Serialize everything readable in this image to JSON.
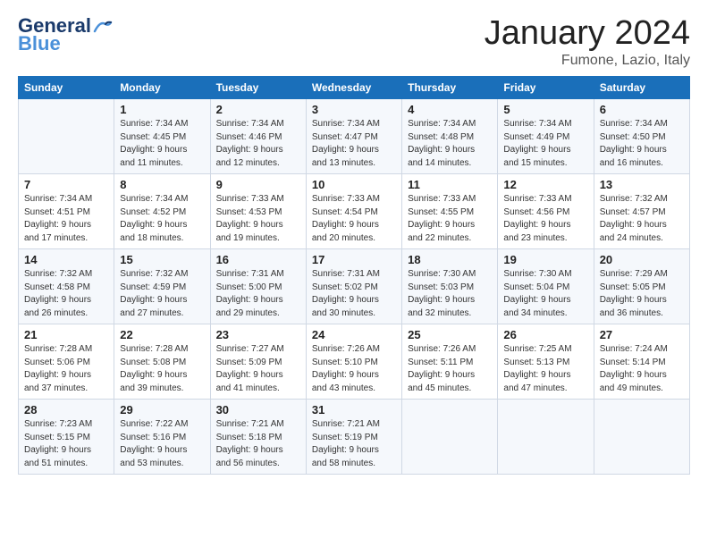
{
  "header": {
    "logo_general": "General",
    "logo_blue": "Blue",
    "month_title": "January 2024",
    "subtitle": "Fumone, Lazio, Italy"
  },
  "days_of_week": [
    "Sunday",
    "Monday",
    "Tuesday",
    "Wednesday",
    "Thursday",
    "Friday",
    "Saturday"
  ],
  "weeks": [
    [
      {
        "day": "",
        "info": ""
      },
      {
        "day": "1",
        "info": "Sunrise: 7:34 AM\nSunset: 4:45 PM\nDaylight: 9 hours\nand 11 minutes."
      },
      {
        "day": "2",
        "info": "Sunrise: 7:34 AM\nSunset: 4:46 PM\nDaylight: 9 hours\nand 12 minutes."
      },
      {
        "day": "3",
        "info": "Sunrise: 7:34 AM\nSunset: 4:47 PM\nDaylight: 9 hours\nand 13 minutes."
      },
      {
        "day": "4",
        "info": "Sunrise: 7:34 AM\nSunset: 4:48 PM\nDaylight: 9 hours\nand 14 minutes."
      },
      {
        "day": "5",
        "info": "Sunrise: 7:34 AM\nSunset: 4:49 PM\nDaylight: 9 hours\nand 15 minutes."
      },
      {
        "day": "6",
        "info": "Sunrise: 7:34 AM\nSunset: 4:50 PM\nDaylight: 9 hours\nand 16 minutes."
      }
    ],
    [
      {
        "day": "7",
        "info": "Sunrise: 7:34 AM\nSunset: 4:51 PM\nDaylight: 9 hours\nand 17 minutes."
      },
      {
        "day": "8",
        "info": "Sunrise: 7:34 AM\nSunset: 4:52 PM\nDaylight: 9 hours\nand 18 minutes."
      },
      {
        "day": "9",
        "info": "Sunrise: 7:33 AM\nSunset: 4:53 PM\nDaylight: 9 hours\nand 19 minutes."
      },
      {
        "day": "10",
        "info": "Sunrise: 7:33 AM\nSunset: 4:54 PM\nDaylight: 9 hours\nand 20 minutes."
      },
      {
        "day": "11",
        "info": "Sunrise: 7:33 AM\nSunset: 4:55 PM\nDaylight: 9 hours\nand 22 minutes."
      },
      {
        "day": "12",
        "info": "Sunrise: 7:33 AM\nSunset: 4:56 PM\nDaylight: 9 hours\nand 23 minutes."
      },
      {
        "day": "13",
        "info": "Sunrise: 7:32 AM\nSunset: 4:57 PM\nDaylight: 9 hours\nand 24 minutes."
      }
    ],
    [
      {
        "day": "14",
        "info": "Sunrise: 7:32 AM\nSunset: 4:58 PM\nDaylight: 9 hours\nand 26 minutes."
      },
      {
        "day": "15",
        "info": "Sunrise: 7:32 AM\nSunset: 4:59 PM\nDaylight: 9 hours\nand 27 minutes."
      },
      {
        "day": "16",
        "info": "Sunrise: 7:31 AM\nSunset: 5:00 PM\nDaylight: 9 hours\nand 29 minutes."
      },
      {
        "day": "17",
        "info": "Sunrise: 7:31 AM\nSunset: 5:02 PM\nDaylight: 9 hours\nand 30 minutes."
      },
      {
        "day": "18",
        "info": "Sunrise: 7:30 AM\nSunset: 5:03 PM\nDaylight: 9 hours\nand 32 minutes."
      },
      {
        "day": "19",
        "info": "Sunrise: 7:30 AM\nSunset: 5:04 PM\nDaylight: 9 hours\nand 34 minutes."
      },
      {
        "day": "20",
        "info": "Sunrise: 7:29 AM\nSunset: 5:05 PM\nDaylight: 9 hours\nand 36 minutes."
      }
    ],
    [
      {
        "day": "21",
        "info": "Sunrise: 7:28 AM\nSunset: 5:06 PM\nDaylight: 9 hours\nand 37 minutes."
      },
      {
        "day": "22",
        "info": "Sunrise: 7:28 AM\nSunset: 5:08 PM\nDaylight: 9 hours\nand 39 minutes."
      },
      {
        "day": "23",
        "info": "Sunrise: 7:27 AM\nSunset: 5:09 PM\nDaylight: 9 hours\nand 41 minutes."
      },
      {
        "day": "24",
        "info": "Sunrise: 7:26 AM\nSunset: 5:10 PM\nDaylight: 9 hours\nand 43 minutes."
      },
      {
        "day": "25",
        "info": "Sunrise: 7:26 AM\nSunset: 5:11 PM\nDaylight: 9 hours\nand 45 minutes."
      },
      {
        "day": "26",
        "info": "Sunrise: 7:25 AM\nSunset: 5:13 PM\nDaylight: 9 hours\nand 47 minutes."
      },
      {
        "day": "27",
        "info": "Sunrise: 7:24 AM\nSunset: 5:14 PM\nDaylight: 9 hours\nand 49 minutes."
      }
    ],
    [
      {
        "day": "28",
        "info": "Sunrise: 7:23 AM\nSunset: 5:15 PM\nDaylight: 9 hours\nand 51 minutes."
      },
      {
        "day": "29",
        "info": "Sunrise: 7:22 AM\nSunset: 5:16 PM\nDaylight: 9 hours\nand 53 minutes."
      },
      {
        "day": "30",
        "info": "Sunrise: 7:21 AM\nSunset: 5:18 PM\nDaylight: 9 hours\nand 56 minutes."
      },
      {
        "day": "31",
        "info": "Sunrise: 7:21 AM\nSunset: 5:19 PM\nDaylight: 9 hours\nand 58 minutes."
      },
      {
        "day": "",
        "info": ""
      },
      {
        "day": "",
        "info": ""
      },
      {
        "day": "",
        "info": ""
      }
    ]
  ]
}
